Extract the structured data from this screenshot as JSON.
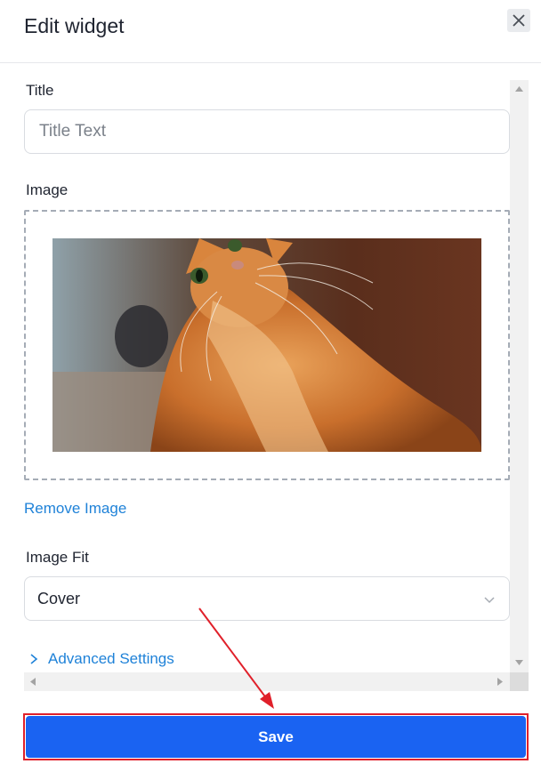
{
  "header": {
    "title": "Edit widget",
    "close_icon": "close-icon"
  },
  "form": {
    "title_label": "Title",
    "title_value": "",
    "title_placeholder": "Title Text",
    "image_label": "Image",
    "image_alt": "orange tabby cat looking up",
    "remove_image_label": "Remove Image",
    "image_fit_label": "Image Fit",
    "image_fit_value": "Cover",
    "advanced_settings_label": "Advanced Settings"
  },
  "footer": {
    "save_label": "Save"
  },
  "colors": {
    "accent": "#1a63f2",
    "link": "#1f82d8",
    "annotation": "#e0202a"
  },
  "icons": [
    "close-icon",
    "chevron-down-icon",
    "chevron-right-icon",
    "scroll-up-arrow-icon",
    "scroll-down-arrow-icon",
    "scroll-left-arrow-icon",
    "scroll-right-arrow-icon"
  ]
}
